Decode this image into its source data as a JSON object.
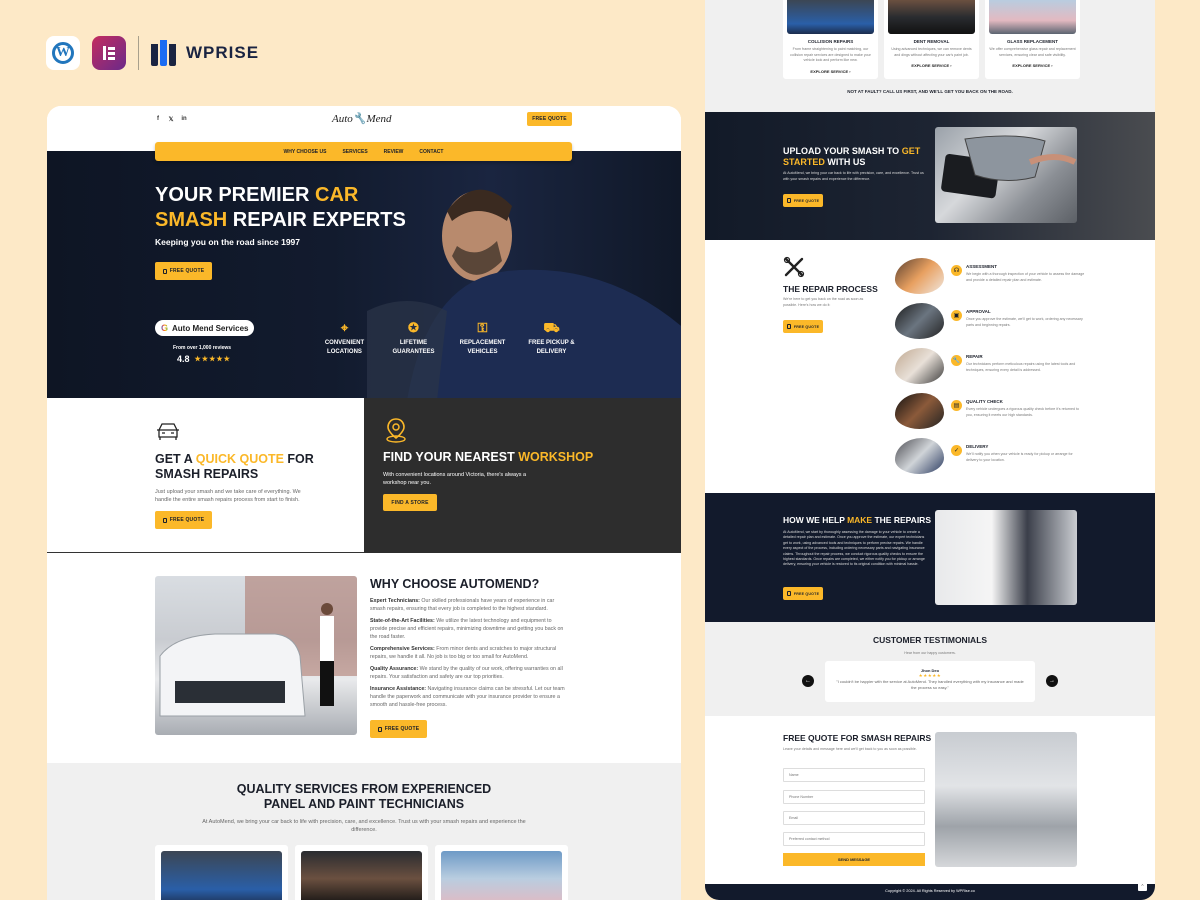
{
  "brand_strip": {
    "wordpress_icon": "wordpress-icon",
    "elementor_icon": "elementor-icon",
    "wprise_label": "WPRISE"
  },
  "site": {
    "social_icons": [
      "facebook-icon",
      "x-icon",
      "linkedin-icon"
    ],
    "logo": "Auto🔧Mend",
    "header_quote_label": "FREE QUOTE",
    "nav": [
      "WHY CHOOSE US",
      "SERVICES",
      "REVIEW",
      "CONTACT"
    ],
    "hero": {
      "title_line1_white": "YOUR PREMIER ",
      "title_line1_yellow": "CAR",
      "title_line2_yellow": "SMASH",
      "title_line2_white": " REPAIR EXPERTS",
      "subtitle": "Keeping you on the road since 1997",
      "cta": "FREE QUOTE",
      "google_badge": "Auto Mend Services",
      "reviews_text": "From over 1,000 reviews",
      "rating": "4.8",
      "stars": "★★★★★",
      "features": [
        {
          "icon": "location-icon",
          "line1": "CONVENIENT",
          "line2": "LOCATIONS"
        },
        {
          "icon": "badge-check-icon",
          "line1": "LIFETIME",
          "line2": "GUARANTEES"
        },
        {
          "icon": "car-key-icon",
          "line1": "REPLACEMENT",
          "line2": "VEHICLES"
        },
        {
          "icon": "delivery-icon",
          "line1": "FREE PICKUP &",
          "line2": "DELIVERY"
        }
      ]
    },
    "quick_quote": {
      "title_a": "GET A ",
      "title_yellow": "QUICK QUOTE",
      "title_b": " FOR SMASH REPAIRS",
      "text": "Just upload your smash and we take care of everything. We handle the entire smash repairs process from start to finish.",
      "cta": "FREE QUOTE"
    },
    "workshop": {
      "title_a": "FIND YOUR NEAREST ",
      "title_yellow": "WORKSHOP",
      "text": "With convenient locations around Victoria, there's always a workshop near you.",
      "cta": "FIND A STORE"
    },
    "why": {
      "title": "WHY CHOOSE AUTOMEND?",
      "items": [
        {
          "label": "Expert Technicians:",
          "text": " Our skilled professionals have years of experience in car smash repairs, ensuring that every job is completed to the highest standard."
        },
        {
          "label": "State-of-the-Art Facilities:",
          "text": " We utilize the latest technology and equipment to provide precise and efficient repairs, minimizing downtime and getting you back on the road faster."
        },
        {
          "label": "Comprehensive Services:",
          "text": " From minor dents and scratches to major structural repairs, we handle it all. No job is too big or too small for AutoMend."
        },
        {
          "label": "Quality Assurance:",
          "text": " We stand by the quality of our work, offering warranties on all repairs. Your satisfaction and safety are our top priorities."
        },
        {
          "label": "Insurance Assistance:",
          "text": " Navigating insurance claims can be stressful. Let our team handle the paperwork and communicate with your insurance provider to ensure a smooth and hassle-free process."
        }
      ],
      "cta": "FREE QUOTE"
    },
    "quality": {
      "title_line1": "QUALITY SERVICES FROM EXPERIENCED",
      "title_line2": "PANEL AND PAINT TECHNICIANS",
      "text": "At AutoMend, we bring your car back to life with precision, care, and excellence. Trust us with your smash repairs and experience the difference."
    },
    "services": [
      {
        "title": "COLLISION REPAIRS",
        "text": "From frame straightening to paint matching, our collision repair services are designed to make your vehicle look and perform like new.",
        "link": "EXPLORE SERVICE ›"
      },
      {
        "title": "DENT REMOVAL",
        "text": "Using advanced techniques, we can remove dents and dings without affecting your car's paint job.",
        "link": "EXPLORE SERVICE ›"
      },
      {
        "title": "GLASS REPLACEMENT",
        "text": "We offer comprehensive glass repair and replacement services, ensuring clear and safe visibility.",
        "link": "EXPLORE SERVICE ›"
      }
    ],
    "not_at_fault": "NOT AT FAULT? CALL US FIRST, AND WE'LL GET YOU BACK ON THE ROAD.",
    "upload": {
      "title_a": "UPLOAD YOUR SMASH TO ",
      "title_yellow": "GET STARTED",
      "title_b": " WITH US",
      "text": "At AutoMend, we bring your car back to life with precision, care, and excellence. Trust us with your smash repairs and experience the difference.",
      "cta": "FREE QUOTE"
    },
    "process": {
      "title": "THE REPAIR PROCESS",
      "text": "We're here to get you back on the road as soon as possible. Here's how we do it:",
      "cta": "FREE QUOTE",
      "steps": [
        {
          "icon": "headset-icon",
          "glyph": "☊",
          "title": "ASSESSMENT",
          "text": "We begin with a thorough inspection of your vehicle to assess the damage and provide a detailed repair plan and estimate."
        },
        {
          "icon": "calendar-icon",
          "glyph": "▣",
          "title": "APPROVAL",
          "text": "Once you approve the estimate, we'll get to work, ordering any necessary parts and beginning repairs."
        },
        {
          "icon": "wrench-icon",
          "glyph": "🔧",
          "title": "REPAIR",
          "text": "Our technicians perform meticulous repairs using the latest tools and techniques, ensuring every detail is addressed."
        },
        {
          "icon": "clipboard-icon",
          "glyph": "▤",
          "title": "QUALITY CHECK",
          "text": "Every vehicle undergoes a rigorous quality check before it's returned to you, ensuring it meets our high standards."
        },
        {
          "icon": "check-icon",
          "glyph": "✓",
          "title": "DELIVERY",
          "text": "We'll notify you when your vehicle is ready for pickup or arrange for delivery to your location."
        }
      ]
    },
    "help": {
      "title_a": "HOW WE HELP ",
      "title_yellow": "MAKE",
      "title_b": " THE REPAIRS",
      "text": "At AutoMend, we start by thoroughly assessing the damage to your vehicle to create a detailed repair plan and estimate. Once you approve the estimate, our expert technicians get to work, using advanced tools and techniques to perform precise repairs. We handle every aspect of the process, including ordering necessary parts and navigating insurance claims. Throughout the repair process, we conduct rigorous quality checks to ensure the highest standards. Once repairs are completed, we either notify you for pickup or arrange delivery, ensuring your vehicle is restored to its original condition with minimal hassle.",
      "cta": "FREE QUOTE"
    },
    "testimonials": {
      "title": "CUSTOMER TESTIMONIALS",
      "subtitle": "Hear from our happy customers.",
      "name": "Jhon Deo",
      "stars": "★★★★★",
      "quote": "\"I couldn't be happier with the service at AutoMend. They handled everything with my insurance and made the process so easy.\"",
      "prev": "←",
      "next": "→"
    },
    "form": {
      "title": "FREE QUOTE FOR SMASH REPAIRS",
      "text": "Leave your details and message here and we'll get back to you as soon as possible.",
      "fields": {
        "name": "Name",
        "phone": "Phone Number",
        "email": "Email",
        "contact": "Preferred contact method"
      },
      "submit": "SEND MESSAGE"
    },
    "footer": "Copyright © 2024. All Rights Reserved by  WPRise.co",
    "back_to_top": "⌃"
  }
}
